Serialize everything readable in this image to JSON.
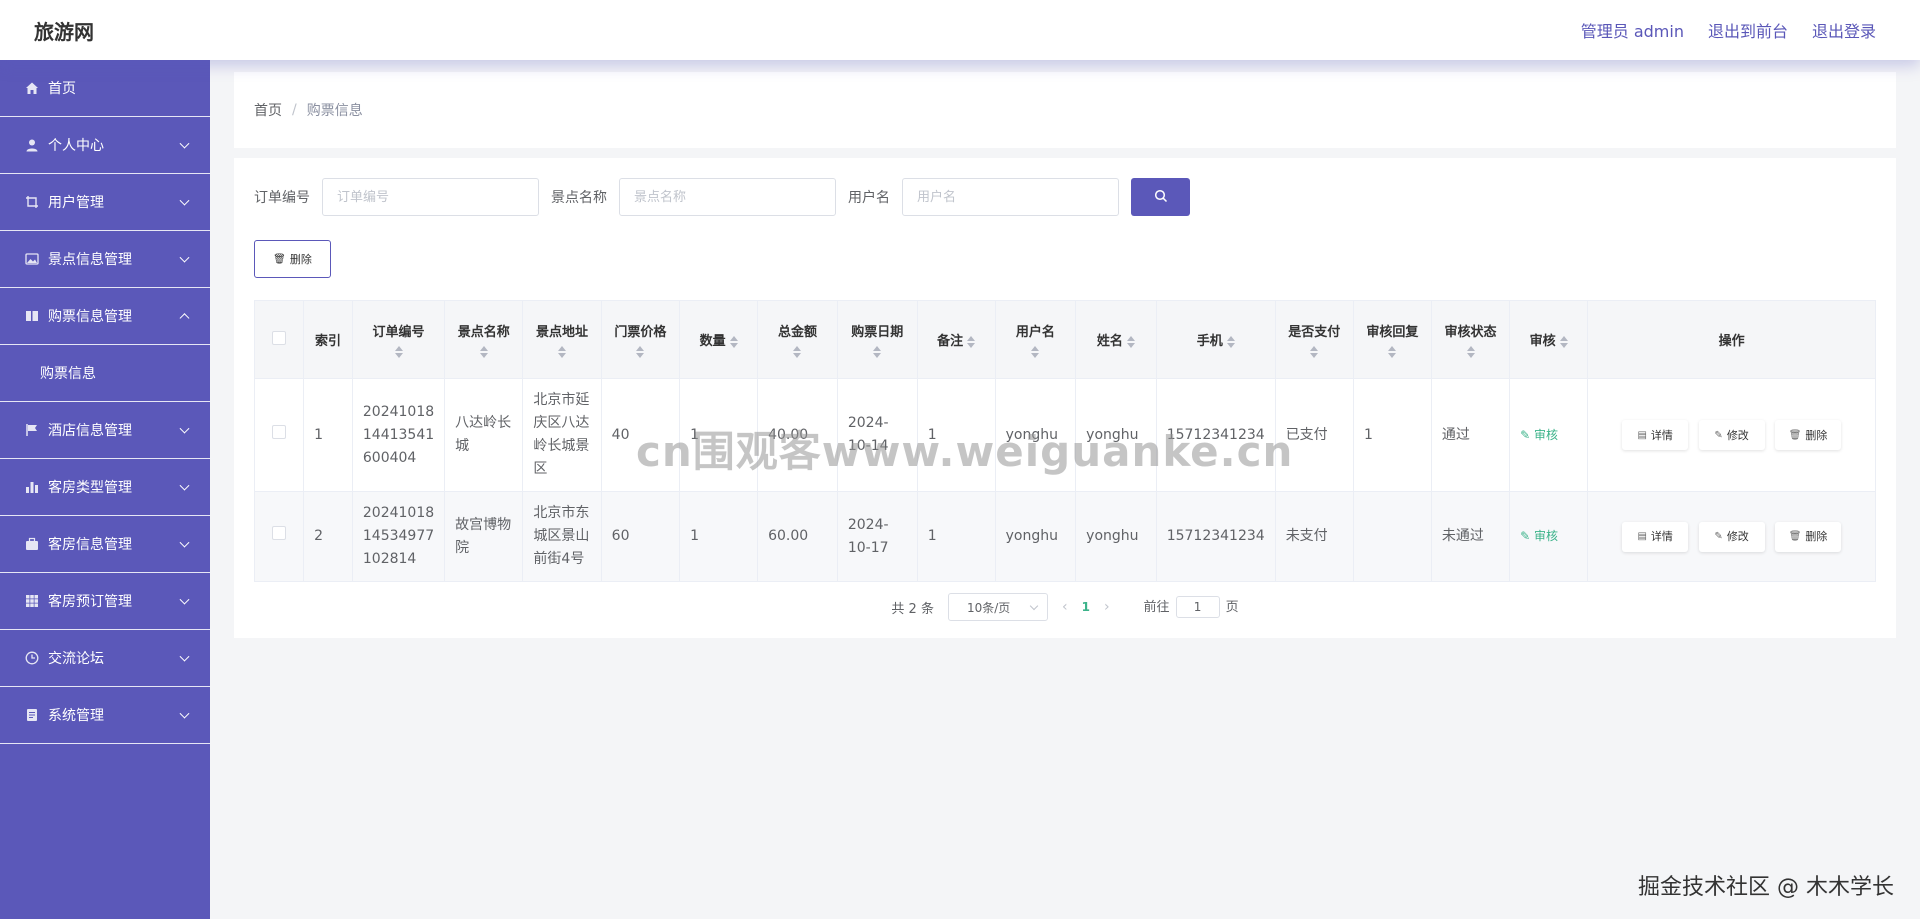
{
  "header": {
    "brand": "旅游网",
    "admin_label": "管理员 admin",
    "exit_front": "退出到前台",
    "logout": "退出登录"
  },
  "sidebar": {
    "items": [
      {
        "label": "首页",
        "icon": "home-icon"
      },
      {
        "label": "个人中心",
        "icon": "user-icon"
      },
      {
        "label": "用户管理",
        "icon": "crop-icon"
      },
      {
        "label": "景点信息管理",
        "icon": "picture-icon"
      },
      {
        "label": "购票信息管理",
        "icon": "ticket-icon"
      },
      {
        "label": "购票信息",
        "icon": ""
      },
      {
        "label": "酒店信息管理",
        "icon": "flag-icon"
      },
      {
        "label": "客房类型管理",
        "icon": "bar-chart-icon"
      },
      {
        "label": "客房信息管理",
        "icon": "briefcase-icon"
      },
      {
        "label": "客房预订管理",
        "icon": "grid-icon"
      },
      {
        "label": "交流论坛",
        "icon": "clock-icon"
      },
      {
        "label": "系统管理",
        "icon": "document-icon"
      }
    ]
  },
  "breadcrumb": {
    "home": "首页",
    "sep": "/",
    "current": "购票信息"
  },
  "search": {
    "order_label": "订单编号",
    "order_placeholder": "订单编号",
    "spot_label": "景点名称",
    "spot_placeholder": "景点名称",
    "user_label": "用户名",
    "user_placeholder": "用户名"
  },
  "toolbar": {
    "delete_label": "删除"
  },
  "table": {
    "headers": [
      "索引",
      "订单编号",
      "景点名称",
      "景点地址",
      "门票价格",
      "数量",
      "总金额",
      "购票日期",
      "备注",
      "用户名",
      "姓名",
      "手机",
      "是否支付",
      "审核回复",
      "审核状态",
      "审核",
      "操作"
    ],
    "rows": [
      {
        "index": "1",
        "order_no": "20241018 14413541 600404",
        "spot": "八达岭长城",
        "address": "北京市延庆区八达岭长城景区",
        "price": "40",
        "qty": "1",
        "total": "40.00",
        "date": "2024-10-14",
        "note": "1",
        "username": "yonghu",
        "name": "yonghu",
        "phone": "15712341234",
        "paid": "已支付",
        "reply": "1",
        "status": "通过",
        "audit": "审核"
      },
      {
        "index": "2",
        "order_no": "20241018 14534977 102814",
        "spot": "故宫博物院",
        "address": "北京市东城区景山前街4号",
        "price": "60",
        "qty": "1",
        "total": "60.00",
        "date": "2024-10-17",
        "note": "1",
        "username": "yonghu",
        "name": "yonghu",
        "phone": "15712341234",
        "paid": "未支付",
        "reply": "",
        "status": "未通过",
        "audit": "审核"
      }
    ],
    "ops": {
      "detail": "详情",
      "edit": "修改",
      "delete": "删除"
    }
  },
  "pager": {
    "total": "共 2 条",
    "page_size": "10条/页",
    "current": "1",
    "goto_label": "前往",
    "goto_value": "1",
    "page_suffix": "页"
  },
  "overlay": {
    "watermark": "cn围观客www.weiguanke.cn",
    "corner": "掘金技术社区 @ 木木学长"
  },
  "colors": {
    "accent": "#5b58b9",
    "link_green": "#3cb38a"
  }
}
